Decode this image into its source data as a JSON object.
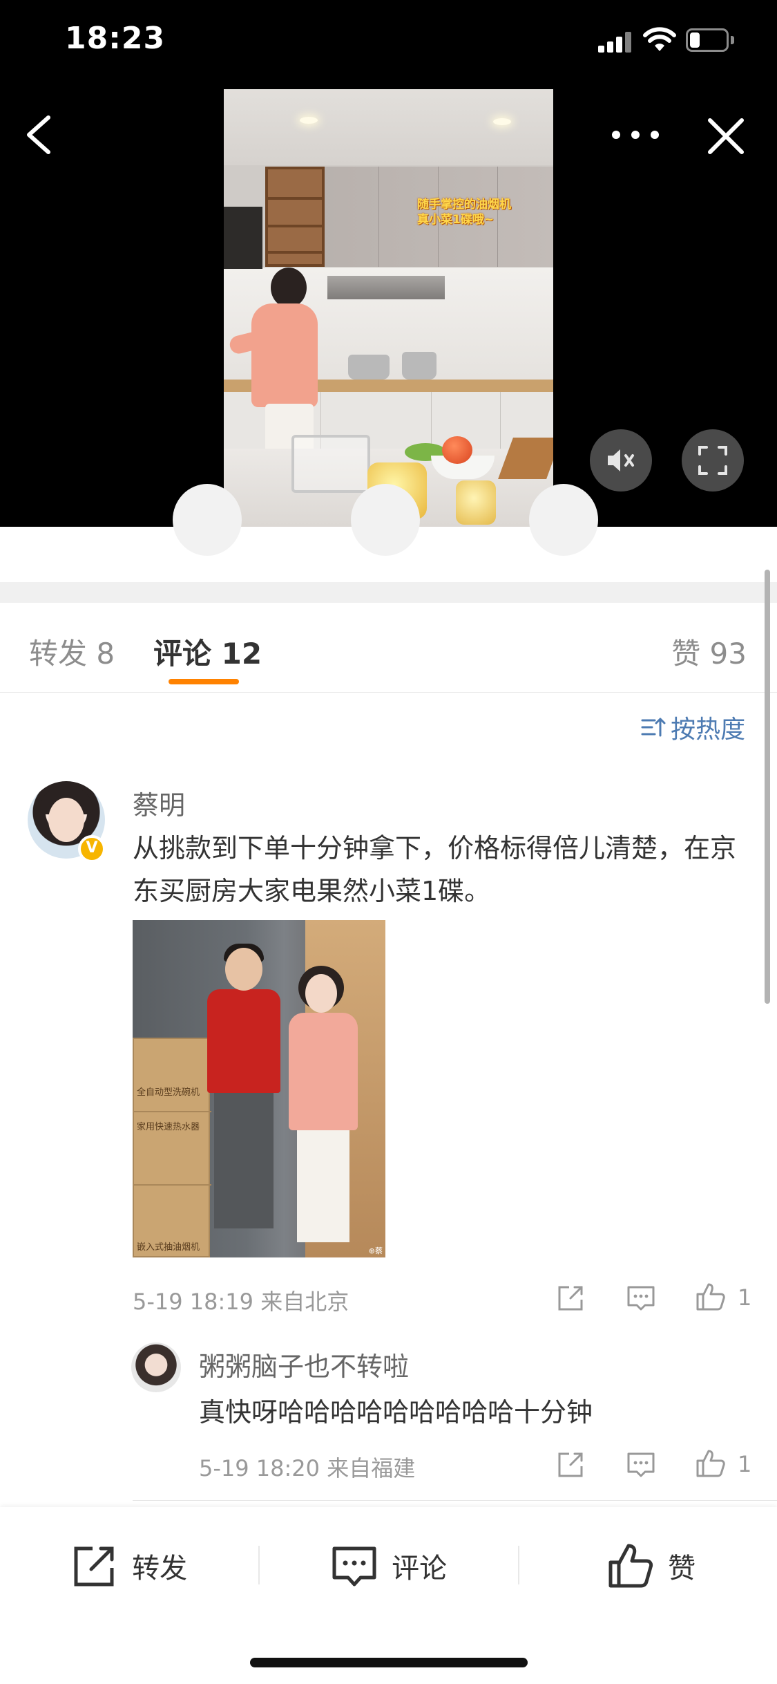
{
  "status_bar": {
    "time": "18:23"
  },
  "video": {
    "caption": "随手掌控的油烟机\n真小菜1碟哦~"
  },
  "tabs": {
    "repost": "转发 8",
    "comment": "评论 12",
    "like": "赞 93"
  },
  "sort": {
    "label": "按热度"
  },
  "comment": {
    "author": "蔡明",
    "verified_badge": "V",
    "text": "从挑款到下单十分钟拿下，价格标得倍儿清楚，在京东买厨房大家电果然小菜1碟。",
    "photo": {
      "box_labels": [
        "全自动型洗碗机",
        "家用快速热水器",
        "嵌入式抽油烟机"
      ],
      "watermark": "⊕蔡"
    },
    "meta": "5-19 18:19  来自北京",
    "like_count": "1",
    "reply": {
      "author": "粥粥脑子也不转啦",
      "text": "真快呀哈哈哈哈哈哈哈哈哈十分钟",
      "meta": "5-19 18:20  来自福建",
      "like_count": "1"
    }
  },
  "bottom_bar": {
    "repost": "转发",
    "comment": "评论",
    "like": "赞"
  },
  "colors": {
    "accent": "#ff8200",
    "link": "#4d7bb2",
    "verified": "#f7b500"
  }
}
